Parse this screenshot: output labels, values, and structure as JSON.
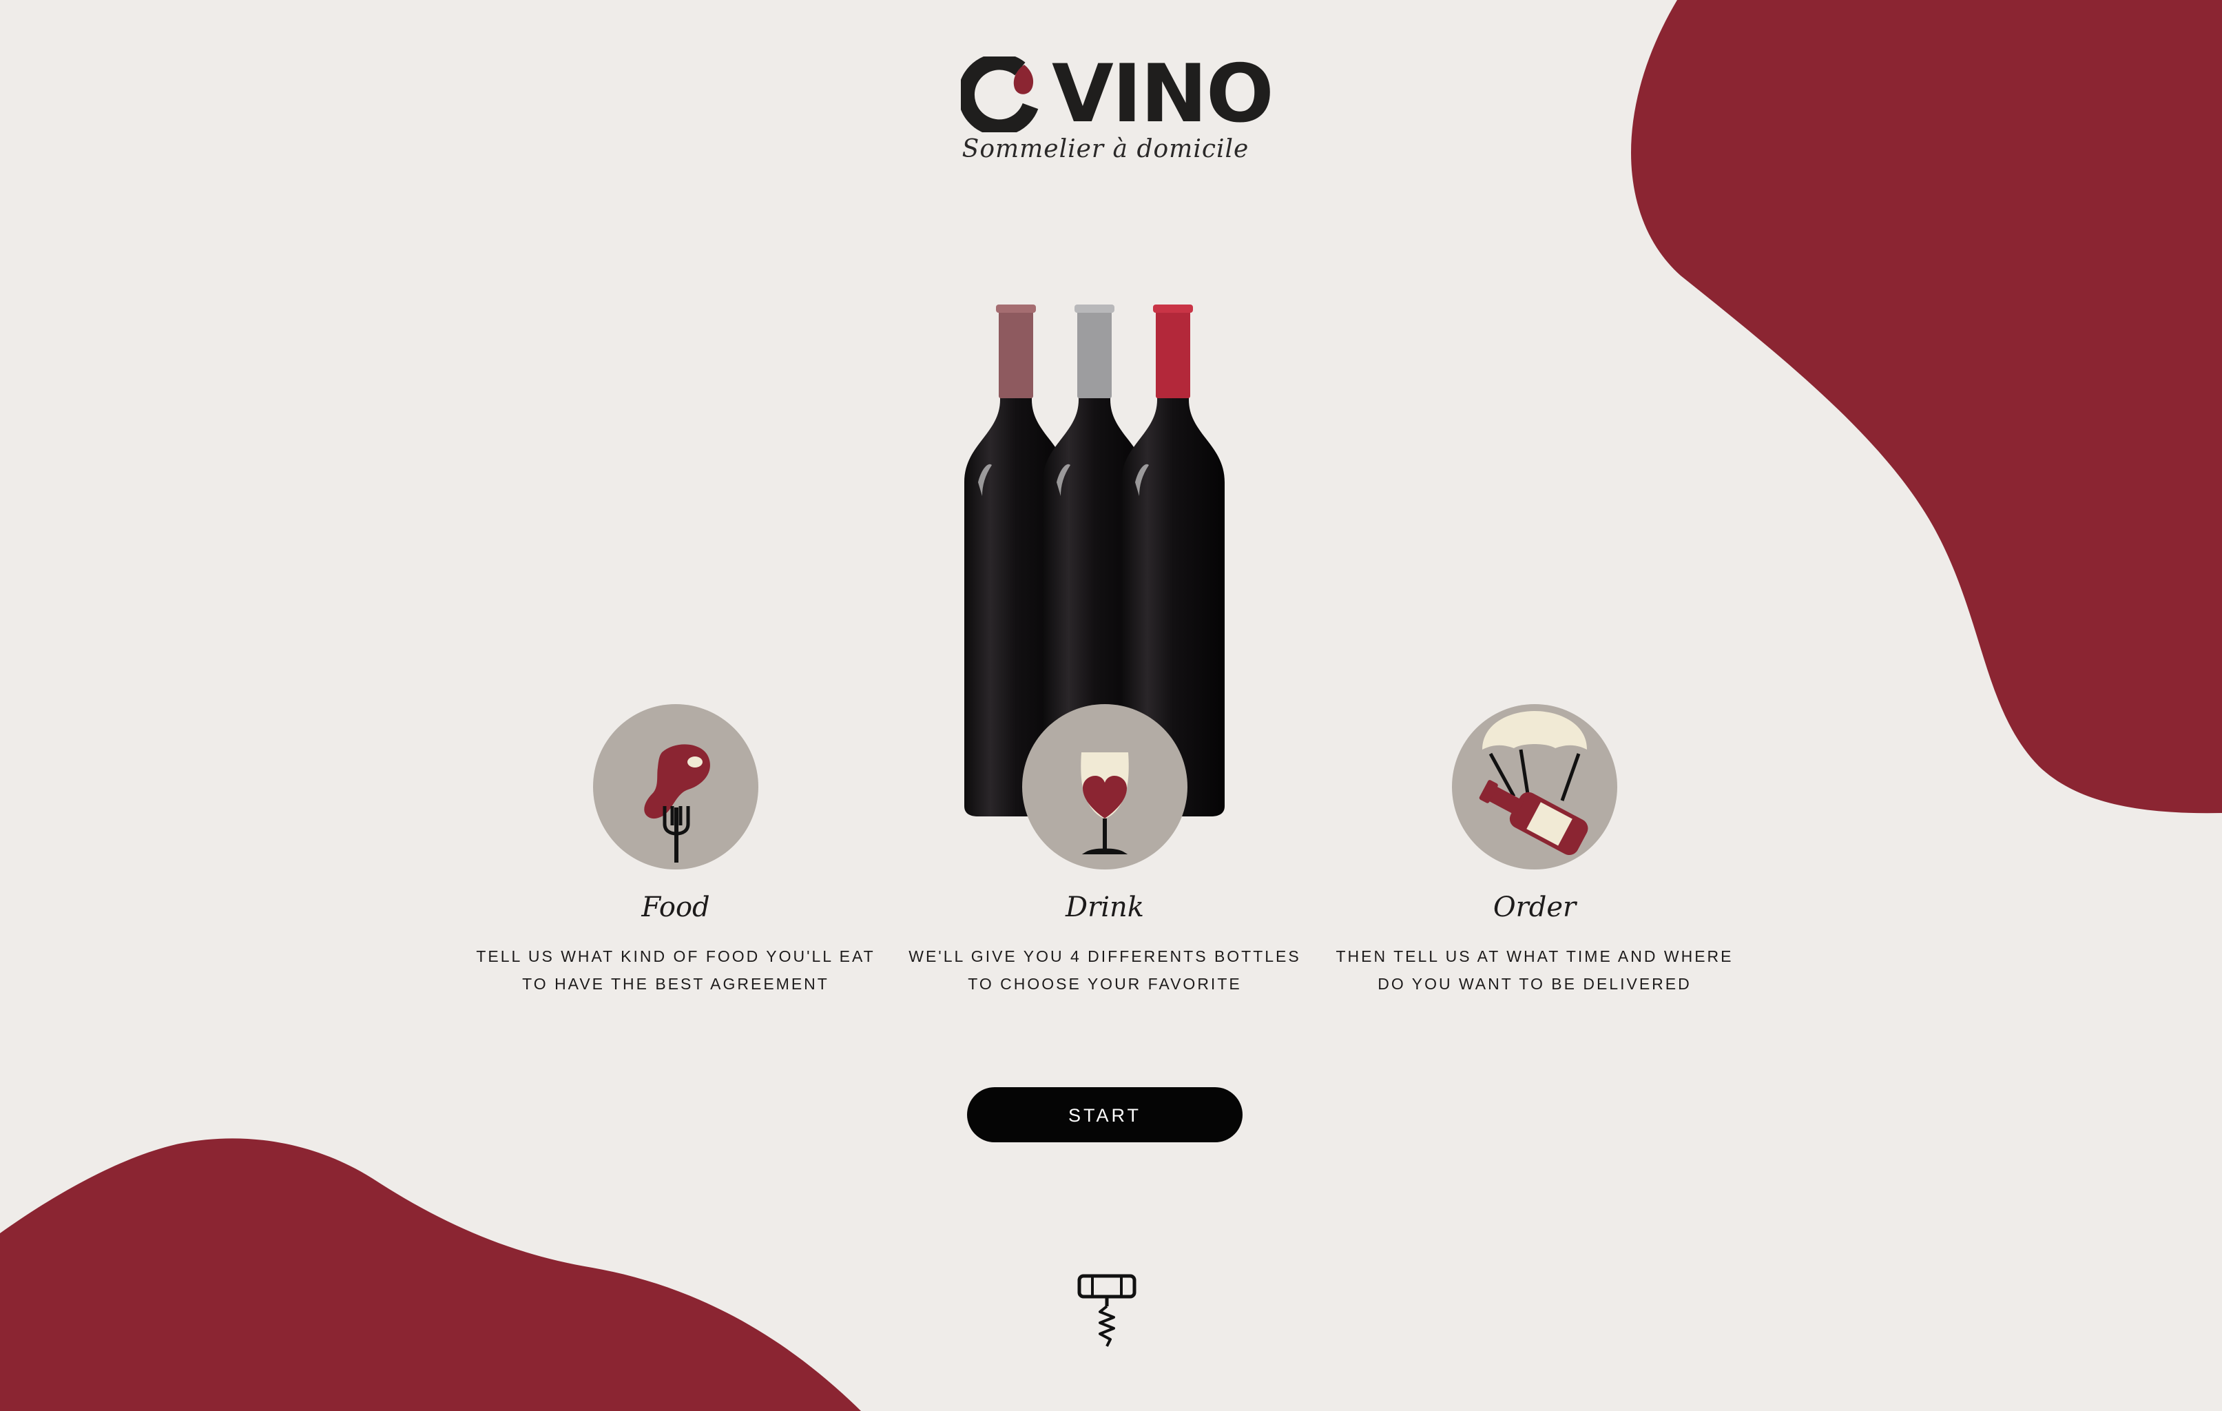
{
  "brand": {
    "logo_text": "VINO",
    "tagline": "Sommelier à domicile",
    "accent_color": "#8b2532",
    "background_color": "#efece9"
  },
  "features": [
    {
      "icon": "steak-fork-icon",
      "title": "Food",
      "line1": "TELL US WHAT KIND OF FOOD YOU'LL EAT",
      "line2": "TO HAVE THE BEST AGREEMENT"
    },
    {
      "icon": "wine-glass-heart-icon",
      "title": "Drink",
      "line1": "WE'LL GIVE YOU 4 DIFFERENTS BOTTLES",
      "line2": "TO CHOOSE YOUR FAVORITE"
    },
    {
      "icon": "parachute-bottle-icon",
      "title": "Order",
      "line1": "THEN TELL US AT WHAT TIME AND WHERE",
      "line2": "DO YOU WANT TO BE DELIVERED"
    }
  ],
  "cta": {
    "start_label": "START"
  },
  "scroll_hint_icon": "corkscrew-icon"
}
